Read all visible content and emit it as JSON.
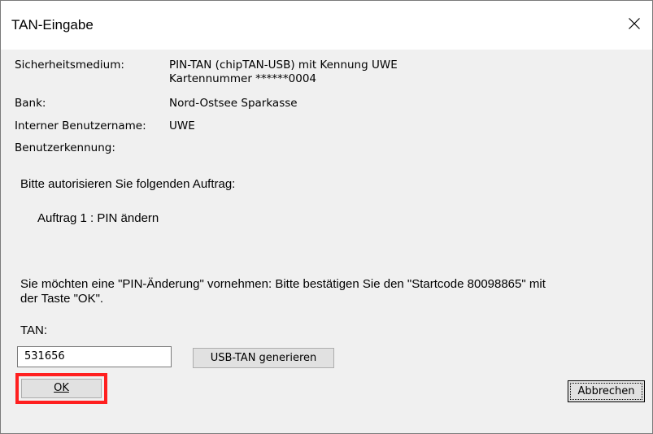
{
  "window": {
    "title": "TAN-Eingabe",
    "close_icon": "close-icon"
  },
  "info": {
    "security_medium_label": "Sicherheitsmedium:",
    "security_medium_value_line1": "PIN-TAN (chipTAN-USB) mit Kennung UWE",
    "security_medium_value_line2": "Kartennummer ******0004",
    "bank_label": "Bank:",
    "bank_value": "Nord-Ostsee Sparkasse",
    "internal_user_label": "Interner Benutzername:",
    "internal_user_value": "UWE",
    "user_id_label": "Benutzerkennung:",
    "user_id_value": ""
  },
  "authorize": {
    "prompt": "Bitte autorisieren Sie folgenden Auftrag:",
    "order": "Auftrag 1 : PIN ändern"
  },
  "instruction": {
    "line1": "Sie möchten eine \"PIN-Änderung\" vornehmen: Bitte bestätigen Sie den \"Startcode 80098865\" mit",
    "line2": "der Taste \"OK\"."
  },
  "tan": {
    "label": "TAN:",
    "value": "531656",
    "generate_button": "USB-TAN generieren"
  },
  "buttons": {
    "ok": "OK",
    "cancel": "Abbrechen"
  },
  "colors": {
    "dialog_background": "#f0f0f0",
    "titlebar_background": "#ffffff",
    "button_background": "#e1e1e1",
    "highlight": "#ff1f1f"
  }
}
